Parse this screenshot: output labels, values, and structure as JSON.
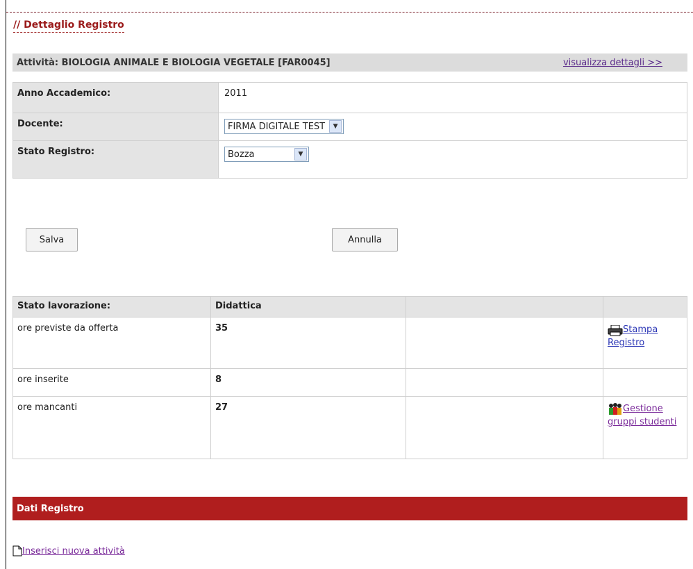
{
  "page": {
    "title": "// Dettaglio Registro"
  },
  "activity": {
    "label": "Attività: BIOLOGIA ANIMALE E BIOLOGIA VEGETALE [FAR0045]",
    "details_link": "visualizza dettagli >>"
  },
  "info": {
    "anno_label": "Anno Accademico:",
    "anno_value": "2011",
    "docente_label": "Docente:",
    "docente_value": "FIRMA DIGITALE TEST",
    "stato_label": "Stato Registro:",
    "stato_value": "Bozza"
  },
  "buttons": {
    "save": "Salva",
    "cancel": "Annulla"
  },
  "stats": {
    "headers": [
      "Stato lavorazione:",
      "Didattica",
      "",
      ""
    ],
    "rows": [
      {
        "label": "ore previste da offerta",
        "value": "35"
      },
      {
        "label": "ore inserite",
        "value": "8"
      },
      {
        "label": "ore mancanti",
        "value": "27"
      }
    ],
    "print_link": "Stampa Registro",
    "groups_link": "Gestione gruppi studenti"
  },
  "dati": {
    "title": "Dati Registro",
    "insert_link": "Inserisci nuova attività"
  },
  "colors": {
    "brand_red": "#b01e1e",
    "title_red": "#9b1b1b",
    "header_gray": "#dcdcdc"
  },
  "icons": {
    "print": "printer-icon",
    "groups": "people-group-icon",
    "new": "new-document-icon",
    "dropdown": "chevron-down-icon"
  }
}
